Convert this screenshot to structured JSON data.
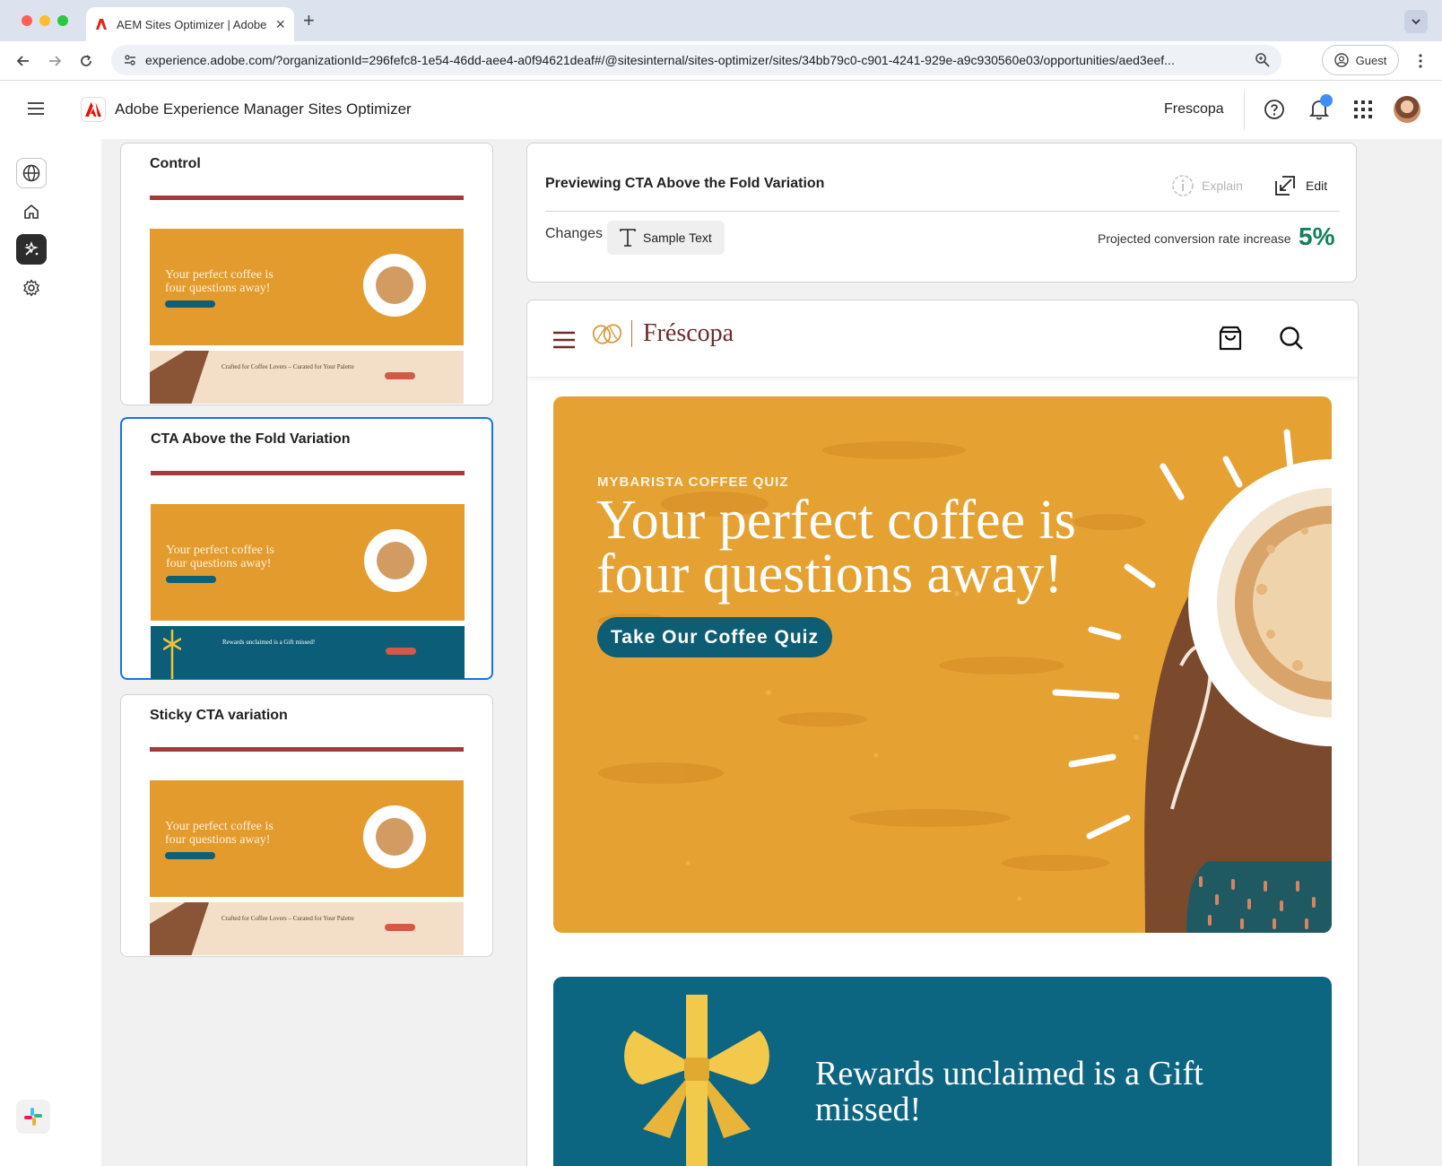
{
  "browser": {
    "tab_title": "AEM Sites Optimizer | Adobe",
    "url": "experience.adobe.com/?organizationId=296fefc8-1e54-46dd-aee4-a0f94621deaf#/@sitesinternal/sites-optimizer/sites/34bb79c0-c901-4241-929e-a9c930560e03/opportunities/aed3eef...",
    "guest_label": "Guest"
  },
  "header": {
    "app_title": "Adobe Experience Manager Sites Optimizer",
    "org_name": "Frescopa"
  },
  "rail": {
    "items": [
      "globe-icon",
      "home-icon",
      "opportunities-icon",
      "settings-icon"
    ],
    "active_index": 2
  },
  "variants": [
    {
      "title": "Control",
      "selected": false,
      "thumb_heading": "Your perfect coffee is four questions away!",
      "thumb_banner": "Crafted for Coffee Lovers – Curated for Your Palette"
    },
    {
      "title": "CTA Above the Fold Variation",
      "selected": true,
      "thumb_heading": "Your perfect coffee is four questions away!",
      "thumb_banner": "Rewards unclaimed is a Gift missed!"
    },
    {
      "title": "Sticky CTA variation",
      "selected": false,
      "thumb_heading": "Your perfect coffee is four questions away!",
      "thumb_banner": "Crafted for Coffee Lovers – Curated for Your Palette"
    }
  ],
  "preview": {
    "title": "Previewing CTA Above the Fold Variation",
    "explain_label": "Explain",
    "edit_label": "Edit",
    "changes_label": "Changes",
    "change_chip": "Sample Text",
    "projected_label": "Projected conversion rate increase",
    "projected_value": "5%",
    "projected_color": "#12805c"
  },
  "site": {
    "brand": "Fréscopa",
    "hero_eyebrow": "MYBARISTA COFFEE QUIZ",
    "hero_title": "Your perfect coffee is four questions away!",
    "hero_cta": "Take Our Coffee Quiz",
    "rewards_title": "Rewards unclaimed is a Gift missed!"
  },
  "colors": {
    "accent": "#1473e6",
    "hero_bg": "#e5a233",
    "cta_bg": "#0d5e75",
    "rewards_bg": "#0c6581",
    "brand": "#6e2a2a"
  }
}
